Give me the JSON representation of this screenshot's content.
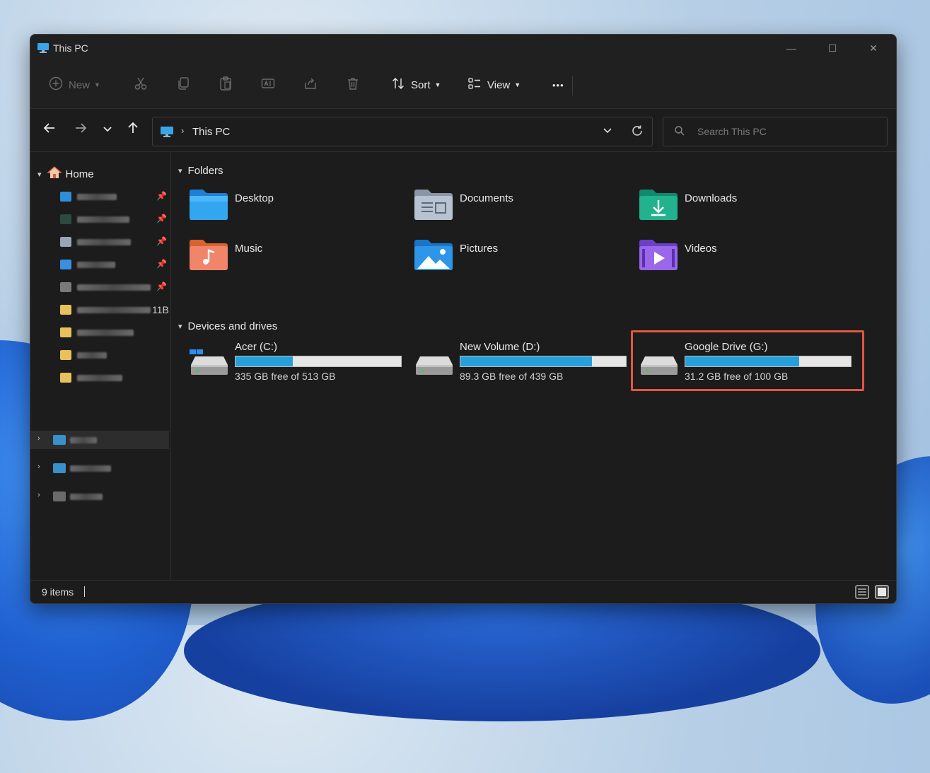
{
  "window": {
    "title": "This PC"
  },
  "window_controls": {
    "minimize": "—",
    "maximize": "☐",
    "close": "✕"
  },
  "toolbar": {
    "new_label": "New",
    "sort_label": "Sort",
    "view_label": "View",
    "more_label": "•••"
  },
  "address": {
    "crumb": "This PC"
  },
  "search": {
    "placeholder": "Search This PC"
  },
  "sidebar": {
    "home_label": "Home",
    "overflow_text": "11B"
  },
  "sections": {
    "folders": "Folders",
    "devices": "Devices and drives"
  },
  "folders": [
    {
      "name": "Desktop"
    },
    {
      "name": "Documents"
    },
    {
      "name": "Downloads"
    },
    {
      "name": "Music"
    },
    {
      "name": "Pictures"
    },
    {
      "name": "Videos"
    }
  ],
  "drives": [
    {
      "name": "Acer (C:)",
      "free_text": "335 GB free of 513 GB",
      "used_fraction": 0.347
    },
    {
      "name": "New Volume (D:)",
      "free_text": "89.3 GB free of 439 GB",
      "used_fraction": 0.797
    },
    {
      "name": "Google Drive (G:)",
      "free_text": "31.2 GB free of 100 GB",
      "used_fraction": 0.688
    }
  ],
  "status": {
    "item_count": "9 items"
  },
  "colors": {
    "accent": "#26a0da",
    "highlight": "#e2573f"
  }
}
